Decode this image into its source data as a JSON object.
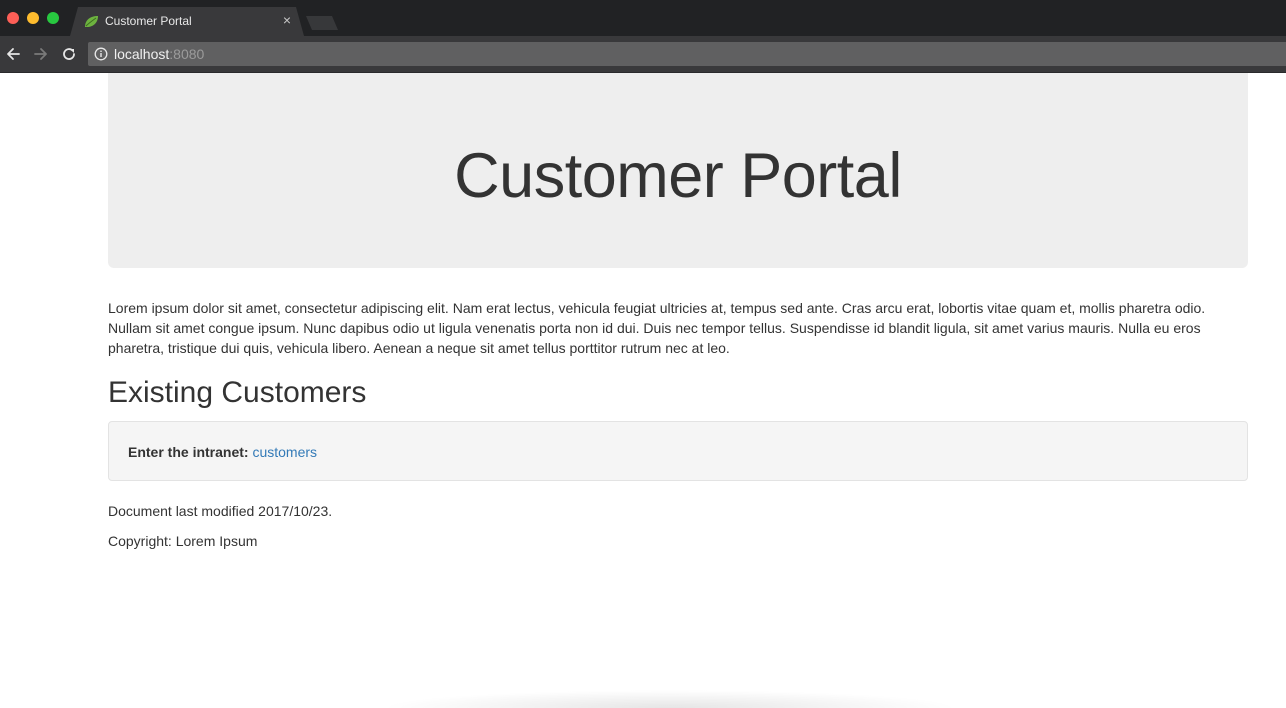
{
  "browser": {
    "tab_title": "Customer Portal",
    "tab_close_glyph": "×",
    "url_host": "localhost",
    "url_port": ":8080"
  },
  "page": {
    "jumbotron_title": "Customer Portal",
    "intro_text": "Lorem ipsum dolor sit amet, consectetur adipiscing elit. Nam erat lectus, vehicula feugiat ultricies at, tempus sed ante. Cras arcu erat, lobortis vitae quam et, mollis pharetra odio. Nullam sit amet congue ipsum. Nunc dapibus odio ut ligula venenatis porta non id dui. Duis nec tempor tellus. Suspendisse id blandit ligula, sit amet varius mauris. Nulla eu eros pharetra, tristique dui quis, vehicula libero. Aenean a neque sit amet tellus porttitor rutrum nec at leo.",
    "section_title": "Existing Customers",
    "intranet_label": "Enter the intranet:",
    "intranet_link": "customers",
    "last_modified": "Document last modified 2017/10/23.",
    "copyright": "Copyright: Lorem Ipsum"
  },
  "colors": {
    "link": "#337ab7",
    "jumbotron_bg": "#eeeeee",
    "well_bg": "#f5f5f5",
    "text": "#333333"
  },
  "icons": {
    "favicon": "spring-leaf-icon",
    "back": "arrow-left-icon",
    "forward": "arrow-right-icon",
    "reload": "reload-icon",
    "info": "info-icon"
  }
}
